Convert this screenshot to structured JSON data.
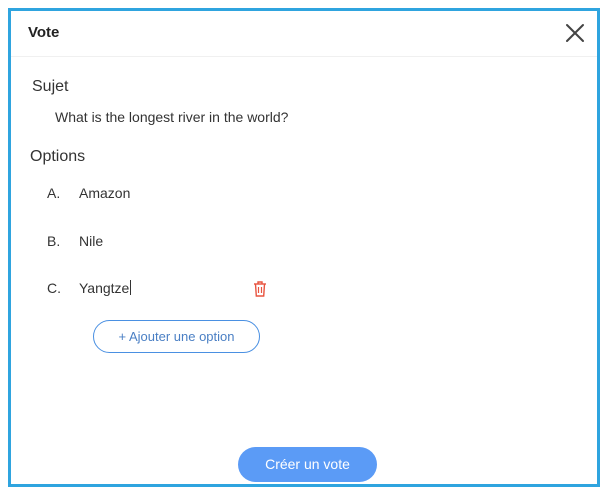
{
  "dialog": {
    "title": "Vote",
    "close_icon": "close-icon"
  },
  "subject": {
    "label": "Sujet",
    "value": "What is the longest river in the world?"
  },
  "options": {
    "label": "Options",
    "items": [
      {
        "letter": "A.",
        "value": "Amazon"
      },
      {
        "letter": "B.",
        "value": "Nile"
      },
      {
        "letter": "C.",
        "value": "Yangtze"
      }
    ],
    "delete_icon": "trash-icon",
    "add_label": "+ Ajouter une option"
  },
  "footer": {
    "create_label": "Créer un vote"
  },
  "colors": {
    "border": "#2fa4df",
    "primary": "#5b9bf6",
    "delete": "#e8533f"
  }
}
